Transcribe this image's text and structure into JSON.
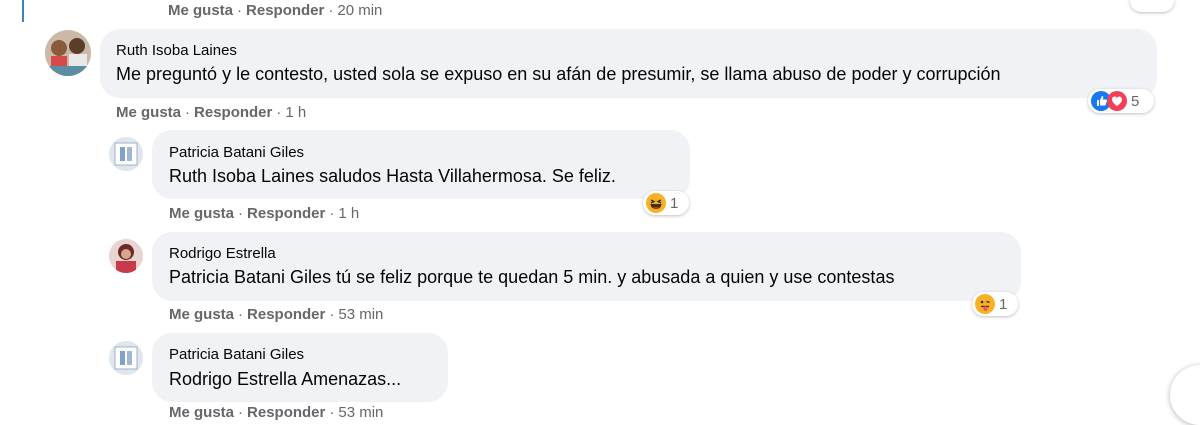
{
  "top_actions": {
    "like": "Me gusta",
    "reply": "Responder",
    "time": "20 min"
  },
  "comments": [
    {
      "author": "Ruth Isoba Laines",
      "mention": "",
      "text": "Me preguntó y le contesto, usted sola se expuso en su afán de presumir, se llama abuso de poder y corrupción",
      "like": "Me gusta",
      "reply": "Responder",
      "time": "1 h",
      "reaction_count": "5"
    },
    {
      "author": "Patricia Batani Giles",
      "mention": "Ruth Isoba Laines",
      "text": " saludos Hasta Villahermosa. Se feliz.",
      "like": "Me gusta",
      "reply": "Responder",
      "time": "1 h",
      "reaction_count": "1"
    },
    {
      "author": "Rodrigo Estrella",
      "mention": "Patricia Batani Giles",
      "text": " tú se feliz porque te quedan 5 min. y abusada a quien y use contestas",
      "like": "Me gusta",
      "reply": "Responder",
      "time": "53 min",
      "reaction_count": "1"
    },
    {
      "author": "Patricia Batani Giles",
      "mention": "Rodrigo Estrella",
      "text": " Amenazas...",
      "like": "Me gusta",
      "reply": "Responder",
      "time": "53 min"
    }
  ],
  "icons": {
    "like": "like-reaction-icon",
    "love": "love-reaction-icon",
    "haha": "haha-reaction-icon",
    "laugh_tongue": "tongue-reaction-icon"
  },
  "colors": {
    "like_blue": "#1877f2",
    "love_red": "#f33e58",
    "haha_yellow": "#f7b125",
    "text_grey": "#65676b",
    "bubble": "#f0f2f5"
  }
}
